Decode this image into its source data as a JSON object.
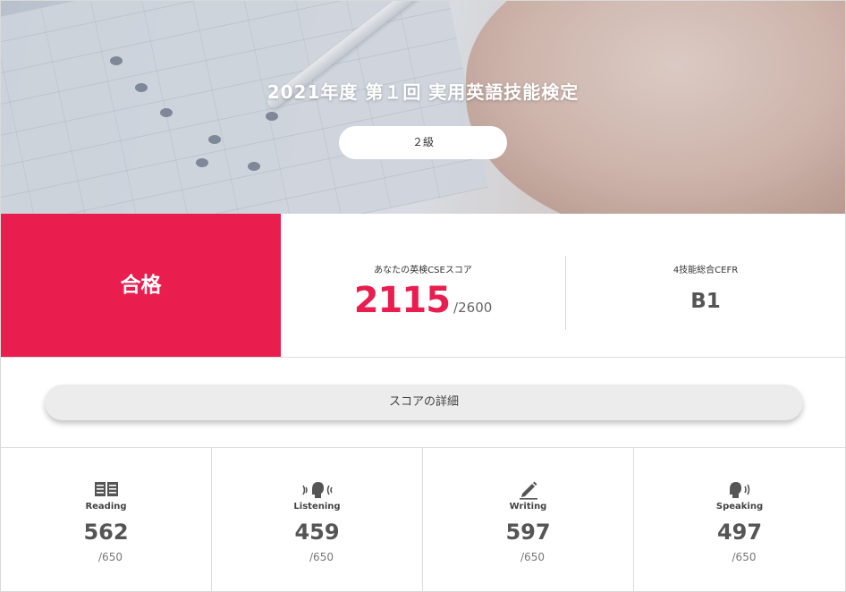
{
  "hero": {
    "title": "2021年度 第１回 実用英語技能検定",
    "grade": "２級"
  },
  "result": {
    "status": "合格",
    "status_color": "#e91e4f",
    "cse_label": "あなたの英検CSEスコア",
    "cse_score": "2115",
    "cse_max": "/2600",
    "cefr_label": "4技能総合CEFR",
    "cefr_value": "B1"
  },
  "detail": {
    "button_label": "スコアの詳細"
  },
  "skills": [
    {
      "icon": "book-icon",
      "name": "Reading",
      "score": "562",
      "max": "/650"
    },
    {
      "icon": "listening-icon",
      "name": "Listening",
      "score": "459",
      "max": "/650"
    },
    {
      "icon": "pencil-icon",
      "name": "Writing",
      "score": "597",
      "max": "/650"
    },
    {
      "icon": "speaking-icon",
      "name": "Speaking",
      "score": "497",
      "max": "/650"
    }
  ]
}
